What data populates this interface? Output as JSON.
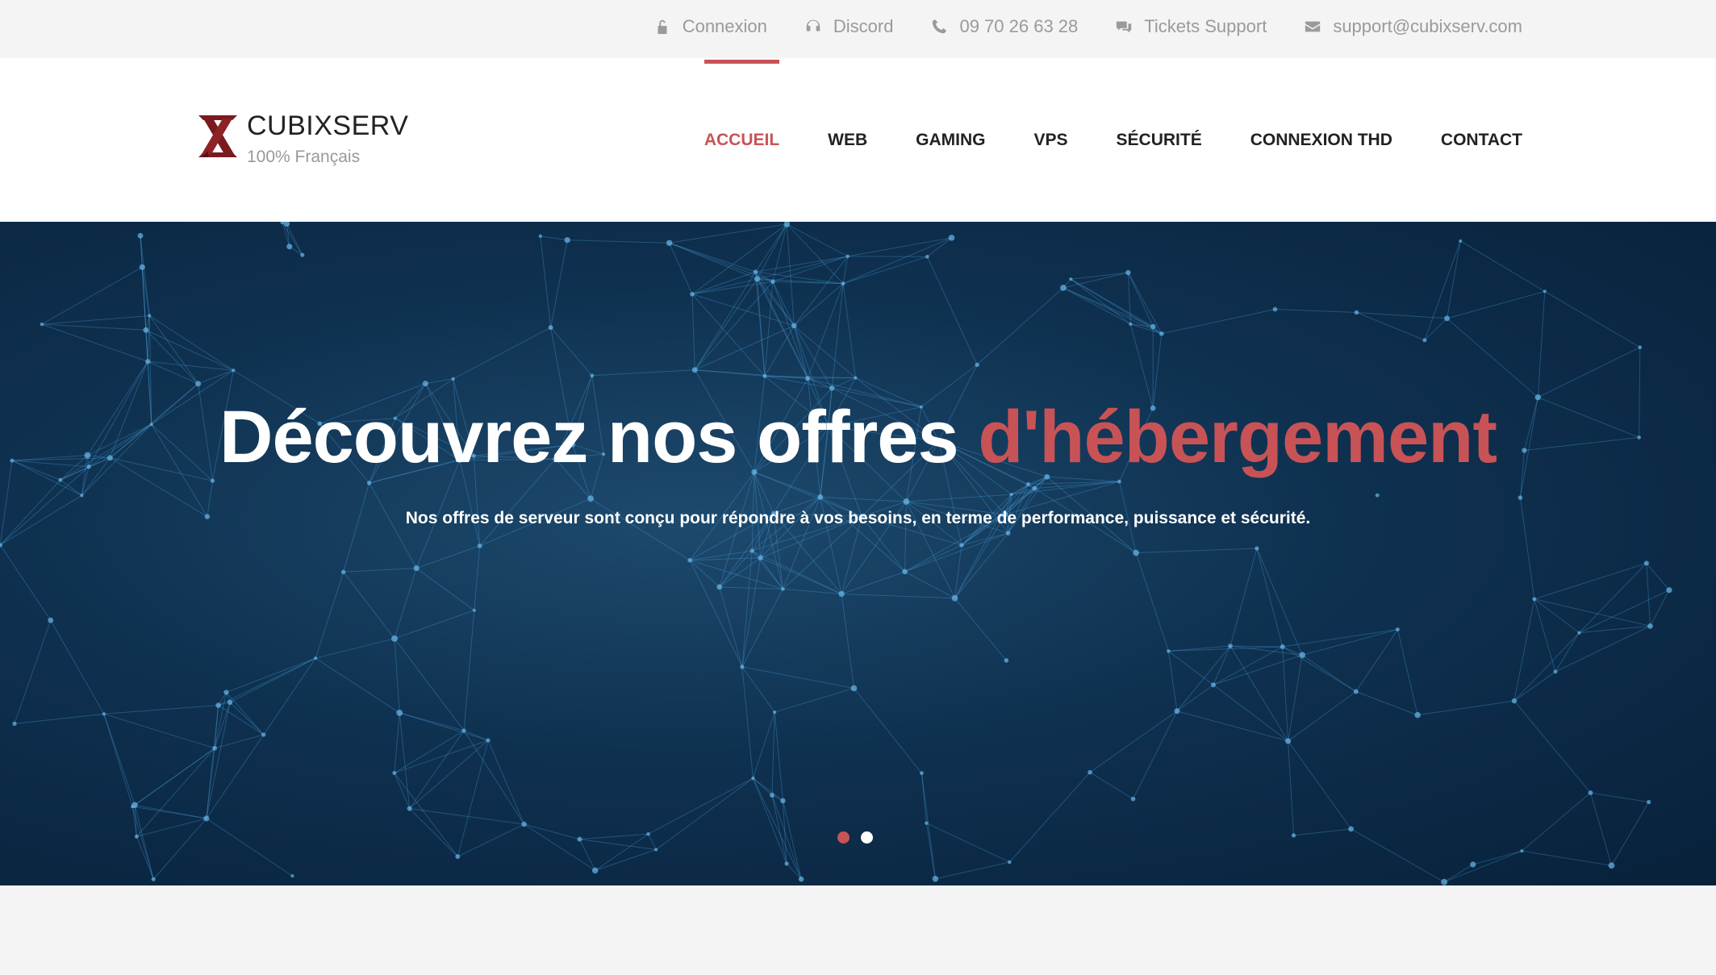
{
  "topbar": {
    "items": [
      {
        "label": "Connexion",
        "icon": "unlock-icon"
      },
      {
        "label": "Discord",
        "icon": "headset-icon"
      },
      {
        "label": "09 70 26 63 28",
        "icon": "phone-icon"
      },
      {
        "label": "Tickets Support",
        "icon": "chat-icon"
      },
      {
        "label": "support@cubixserv.com",
        "icon": "envelope-icon"
      }
    ]
  },
  "brand": {
    "name": "CUBIXSERV",
    "tagline": "100% Français",
    "logo_color": "#7a1a1e"
  },
  "nav": {
    "items": [
      {
        "label": "ACCUEIL",
        "active": true
      },
      {
        "label": "WEB"
      },
      {
        "label": "GAMING"
      },
      {
        "label": "VPS"
      },
      {
        "label": "SÉCURITÉ"
      },
      {
        "label": "CONNEXION THD"
      },
      {
        "label": "CONTACT"
      }
    ]
  },
  "hero": {
    "title_main": "Découvrez nos offres ",
    "title_accent": "d'hébergement",
    "subtitle": "Nos offres de serveur sont conçu pour répondre à vos besoins, en terme de performance, puissance et sécurité.",
    "slides": 2,
    "active_slide": 1
  },
  "colors": {
    "accent": "#c85356",
    "hero_bg": "#0f3150",
    "topbar_text": "#9a9a9a"
  }
}
